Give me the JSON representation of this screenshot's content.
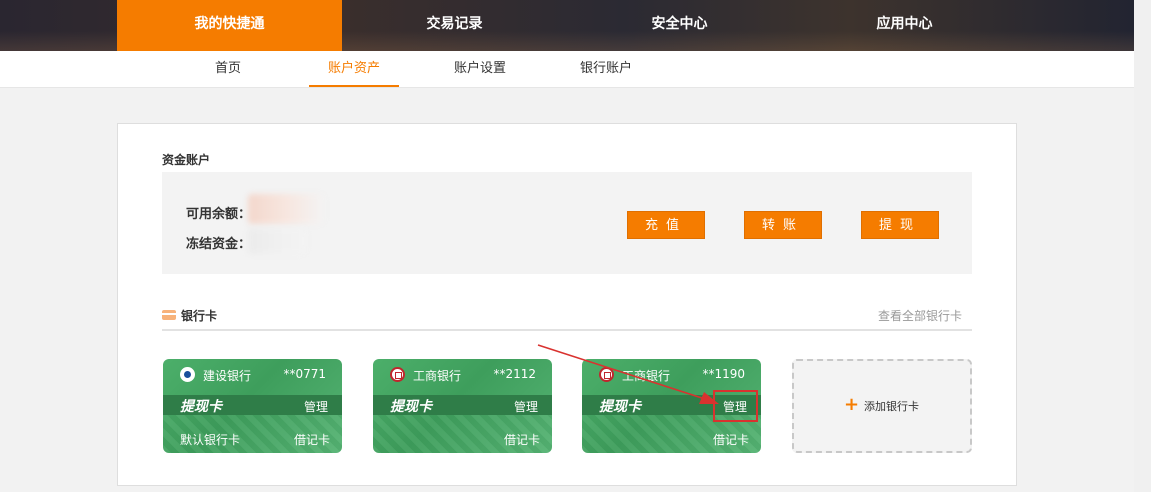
{
  "topnav": [
    "我的快捷通",
    "交易记录",
    "安全中心",
    "应用中心"
  ],
  "subnav": [
    "首页",
    "账户资产",
    "账户设置",
    "银行账户"
  ],
  "fund": {
    "title": "资金账户",
    "available_label": "可用余额：",
    "frozen_label": "冻结资金：",
    "buttons": [
      "充值",
      "转账",
      "提现"
    ]
  },
  "bank": {
    "title": "银行卡",
    "view_all": "查看全部银行卡",
    "cards": [
      {
        "bank": "建设银行",
        "logo": "ccb-logo-icon",
        "number": "**0771",
        "label": "提现卡",
        "manage": "管理",
        "default": "默认银行卡",
        "type": "借记卡"
      },
      {
        "bank": "工商银行",
        "logo": "icbc-logo-icon",
        "number": "**2112",
        "label": "提现卡",
        "manage": "管理",
        "default": "",
        "type": "借记卡"
      },
      {
        "bank": "工商银行",
        "logo": "icbc-logo-icon",
        "number": "**1190",
        "label": "提现卡",
        "manage": "管理",
        "default": "",
        "type": "借记卡"
      }
    ],
    "add_card": {
      "icon": "plus-icon",
      "text": "添加银行卡"
    }
  },
  "colors": {
    "accent": "#f57c00",
    "card_green": "#4caf6a",
    "highlight": "#d9322f"
  }
}
